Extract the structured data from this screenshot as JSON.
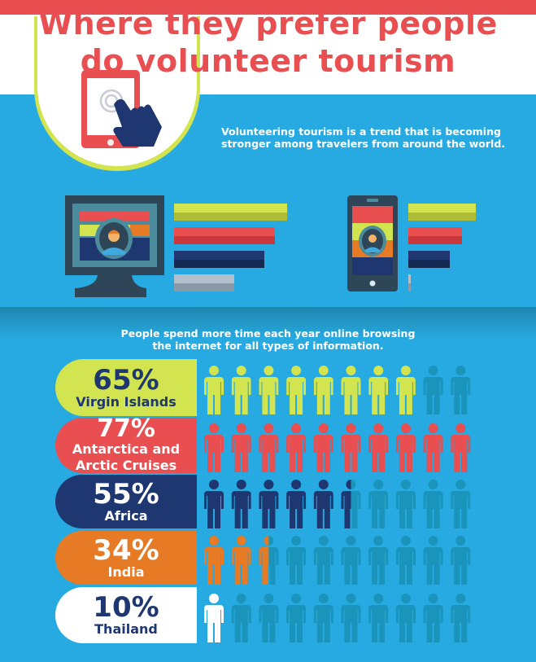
{
  "title_line1": "Where they prefer people",
  "title_line2": "do volunteer tourism",
  "intro_line1": "Volunteering tourism is a trend that is becoming",
  "intro_line2": "stronger among travelers from around the world.",
  "sub_line1": "People spend more time each year online browsing",
  "sub_line2": "the internet for all types of information.",
  "colors": {
    "red": "#E94E51",
    "lime": "#D2E550",
    "navy": "#1F3770",
    "orange": "#E67A25",
    "white": "#FFFFFF",
    "empty": "#1A94BA",
    "bg": "#27AAE1"
  },
  "device_bars": {
    "desktop": [
      {
        "color": "lime",
        "value": 0.95
      },
      {
        "color": "red",
        "value": 0.85
      },
      {
        "color": "navy",
        "value": 0.76
      },
      {
        "color": "gray",
        "value": 0.51
      }
    ],
    "mobile": [
      {
        "color": "lime",
        "value": 0.57
      },
      {
        "color": "red",
        "value": 0.45
      },
      {
        "color": "navy",
        "value": 0.35
      },
      {
        "color": "gray",
        "value": 0.02
      }
    ]
  },
  "destinations": [
    {
      "percent": "65%",
      "name": "Virgin Islands",
      "color": "#D2E550",
      "text": "#1F3770",
      "filled": 8,
      "total": 10
    },
    {
      "percent": "77%",
      "name": "Antarctica and Arctic Cruises",
      "color": "#E94E51",
      "text": "#FFFFFF",
      "filled": 10,
      "total": 10
    },
    {
      "percent": "55%",
      "name": "Africa",
      "color": "#1F3770",
      "text": "#FFFFFF",
      "filled": 5.5,
      "total": 10
    },
    {
      "percent": "34%",
      "name": "India",
      "color": "#E67A25",
      "text": "#FFFFFF",
      "filled": 2.5,
      "total": 10
    },
    {
      "percent": "10%",
      "name": "Thailand",
      "color": "#FFFFFF",
      "text": "#1F3770",
      "filled": 1,
      "total": 10
    }
  ]
}
